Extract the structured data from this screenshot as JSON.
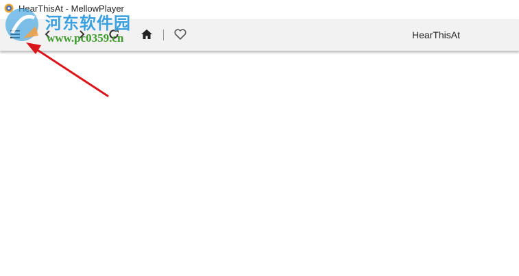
{
  "window": {
    "title": "HearThisAt - MellowPlayer"
  },
  "toolbar": {
    "menu_icon": "menu-icon",
    "back_icon": "chevron-left-icon",
    "forward_icon": "chevron-right-icon",
    "reload_icon": "reload-icon",
    "home_icon": "home-icon",
    "favorite_icon": "heart-outline-icon",
    "service_title": "HearThisAt"
  },
  "watermark": {
    "site_name": "河东软件园",
    "url": "www.pc0359.cn"
  },
  "colors": {
    "toolbar_bg": "#f2f2f2",
    "annotation_arrow": "#d9141a",
    "watermark_blue": "#3aa0e0",
    "watermark_green": "#3c9a2a"
  }
}
